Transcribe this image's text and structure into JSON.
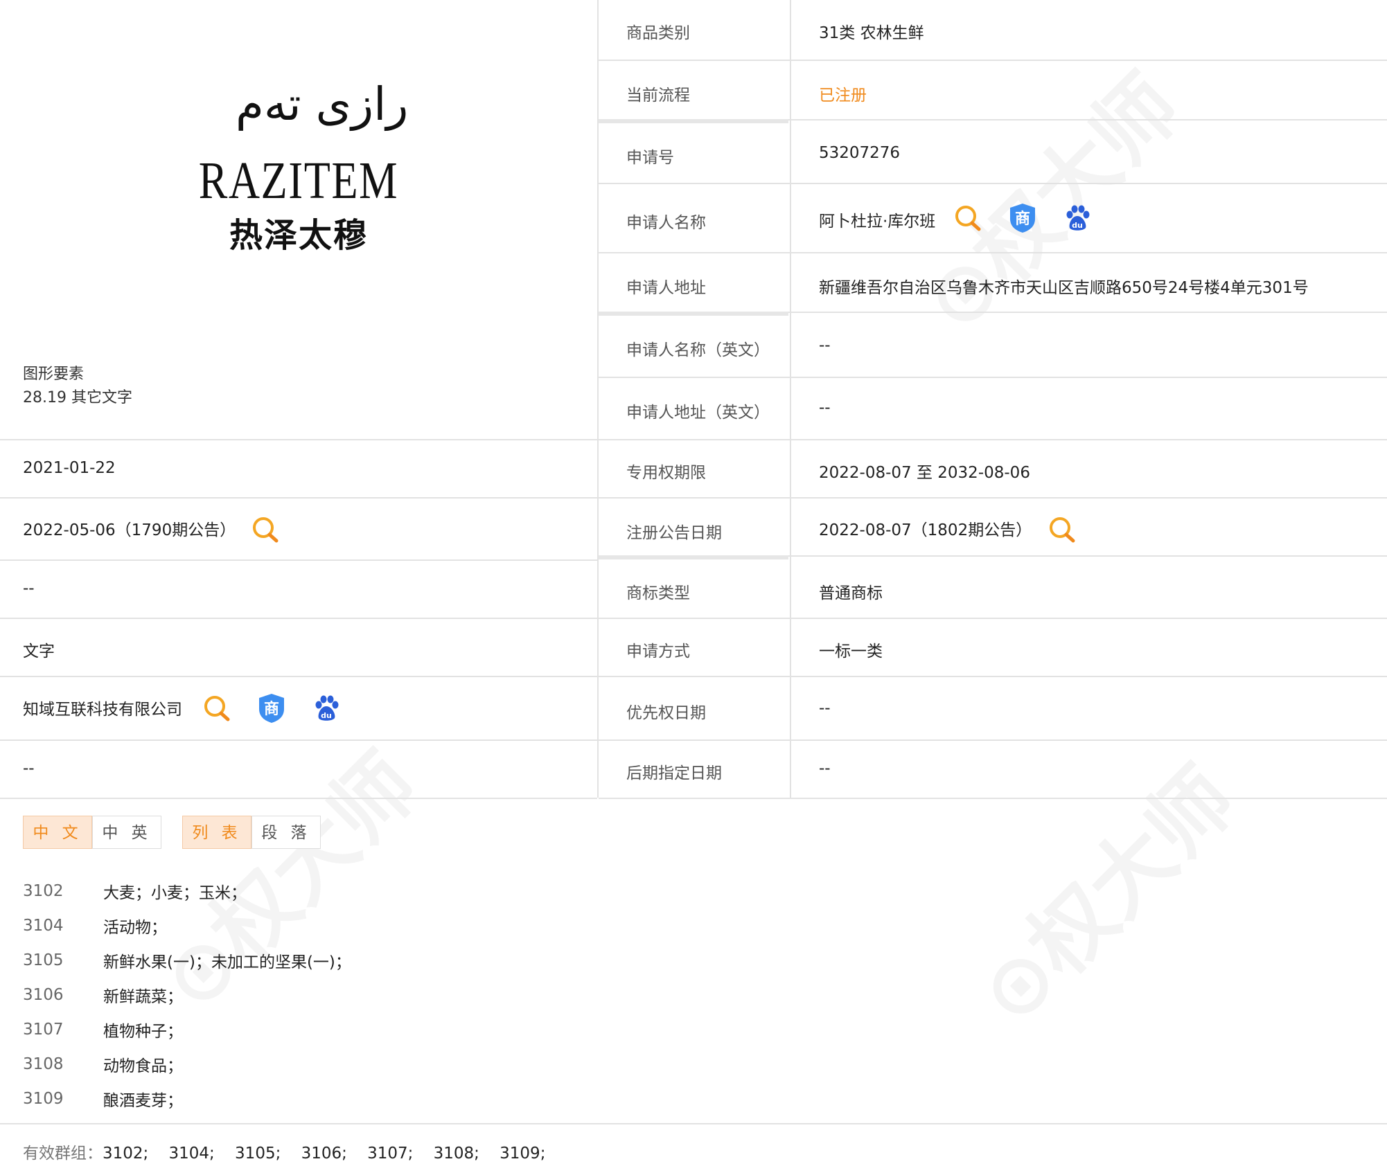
{
  "mark": {
    "arabic_text": "رازی تەم",
    "latin_text": "RAZITEM",
    "chinese_text": "热泽太穆",
    "graphic_label": "图形要素",
    "graphic_value": "28.19 其它文字"
  },
  "left_values": {
    "apply_date": "2021-01-22",
    "prelim_pub": "2022-05-06（1790期公告）",
    "row3": "--",
    "mark_form": "文字",
    "agent": "知域互联科技有限公司",
    "row6": "--"
  },
  "details": [
    {
      "label": "商品类别",
      "value": "31类 农林生鲜"
    },
    {
      "label": "当前流程",
      "value": "已注册"
    },
    {
      "label": "申请号",
      "value": "53207276"
    },
    {
      "label": "申请人名称",
      "value": "阿卜杜拉·库尔班"
    },
    {
      "label": "申请人地址",
      "value": "新疆维吾尔自治区乌鲁木齐市天山区吉顺路650号24号楼4单元301号"
    },
    {
      "label": "申请人名称（英文）",
      "value": "--"
    },
    {
      "label": "申请人地址（英文）",
      "value": "--"
    },
    {
      "label": "专用权期限",
      "value": "2022-08-07 至 2032-08-06"
    },
    {
      "label": "注册公告日期",
      "value": "2022-08-07（1802期公告）"
    },
    {
      "label": "商标类型",
      "value": "普通商标"
    },
    {
      "label": "申请方式",
      "value": "一标一类"
    },
    {
      "label": "优先权日期",
      "value": "--"
    },
    {
      "label": "后期指定日期",
      "value": "--"
    }
  ],
  "tabs": {
    "lang_cn": "中 文",
    "lang_cn_en": "中 英",
    "view_list": "列 表",
    "view_para": "段 落"
  },
  "goods": [
    {
      "code": "3102",
      "text": "大麦；小麦；玉米；"
    },
    {
      "code": "3104",
      "text": "活动物；"
    },
    {
      "code": "3105",
      "text": "新鲜水果(一)；未加工的坚果(一)；"
    },
    {
      "code": "3106",
      "text": "新鲜蔬菜；"
    },
    {
      "code": "3107",
      "text": "植物种子；"
    },
    {
      "code": "3108",
      "text": "动物食品；"
    },
    {
      "code": "3109",
      "text": "酿酒麦芽；"
    }
  ],
  "groups": {
    "label": "有效群组：",
    "value": "3102;    3104;    3105;    3106;    3107;    3108;    3109;"
  },
  "icons": {
    "search": "search-icon",
    "trademark_office": "shang-shield-icon",
    "baidu": "baidu-paw-icon"
  },
  "colors": {
    "accent_orange": "#f08a1c",
    "shield_blue": "#3d8ef0",
    "baidu_blue": "#2b5fd9"
  }
}
